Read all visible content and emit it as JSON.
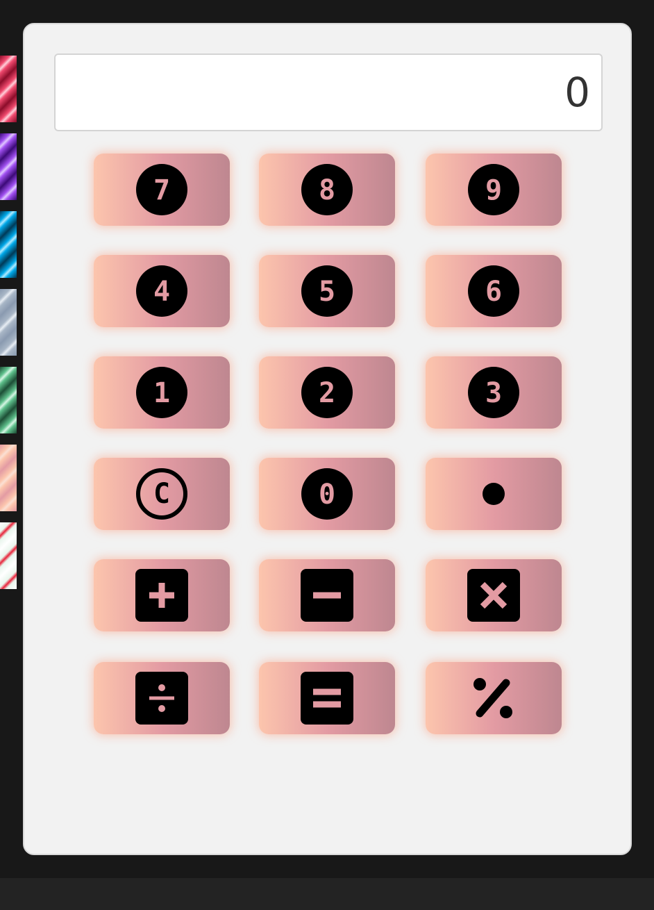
{
  "display": {
    "value": "0"
  },
  "colors": {
    "key_gradient": [
      "#fcc5ad",
      "#e39ba3",
      "#be8790"
    ],
    "key_glyph": "#000000",
    "key_glyph_text": "#e39ba3"
  },
  "keys": [
    {
      "label": "7",
      "icon": "circle-7-icon"
    },
    {
      "label": "8",
      "icon": "circle-8-icon"
    },
    {
      "label": "9",
      "icon": "circle-9-icon"
    },
    {
      "label": "4",
      "icon": "circle-4-icon"
    },
    {
      "label": "5",
      "icon": "circle-5-icon"
    },
    {
      "label": "6",
      "icon": "circle-6-icon"
    },
    {
      "label": "1",
      "icon": "circle-1-icon"
    },
    {
      "label": "2",
      "icon": "circle-2-icon"
    },
    {
      "label": "3",
      "icon": "circle-3-icon"
    },
    {
      "label": "C",
      "icon": "copyright-c-icon"
    },
    {
      "label": "0",
      "icon": "circle-0-icon"
    },
    {
      "label": "",
      "icon": "dot-icon"
    },
    {
      "label": "",
      "icon": "square-plus-icon"
    },
    {
      "label": "",
      "icon": "square-minus-icon"
    },
    {
      "label": "",
      "icon": "square-multiply-icon"
    },
    {
      "label": "",
      "icon": "square-divide-icon"
    },
    {
      "label": "",
      "icon": "square-equals-icon"
    },
    {
      "label": "",
      "icon": "percent-icon"
    }
  ],
  "theme_swatches": [
    {
      "name": "crimson",
      "colors": [
        "#8c0d2a",
        "#f04a6e",
        "#ffd0da"
      ]
    },
    {
      "name": "violet",
      "colors": [
        "#3c0a78",
        "#a050f0",
        "#e0c8ff"
      ]
    },
    {
      "name": "cyan",
      "colors": [
        "#003a58",
        "#00a8e8",
        "#b0eaff"
      ]
    },
    {
      "name": "slate",
      "colors": [
        "#8a9ab0",
        "#a8b6c6",
        "#e8eef4"
      ]
    },
    {
      "name": "mint",
      "colors": [
        "#1d4f36",
        "#5fc08c",
        "#d6f5e4"
      ]
    },
    {
      "name": "peach",
      "colors": [
        "#e39ba3",
        "#fcc5ad",
        "#fbe0d4"
      ]
    },
    {
      "name": "flag",
      "colors": [
        "#ffffff",
        "#e8f5ec",
        "#e8233a"
      ]
    }
  ]
}
